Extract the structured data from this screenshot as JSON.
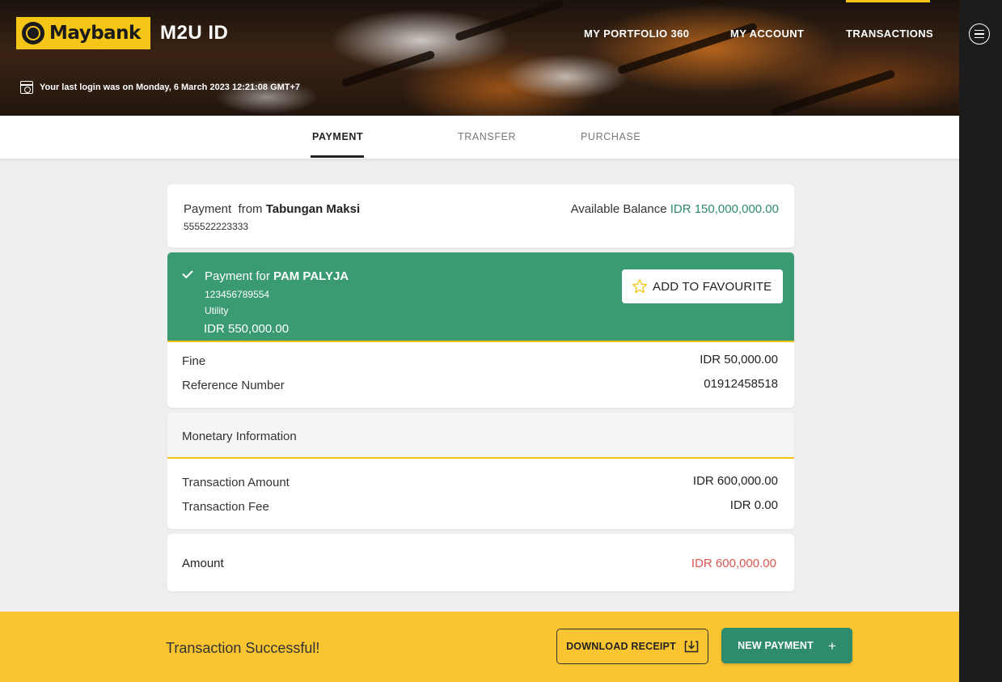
{
  "header": {
    "brand": "Maybank",
    "app_name": "M2U ID",
    "nav": {
      "portfolio": "MY PORTFOLIO 360",
      "account": "MY ACCOUNT",
      "transactions": "TRANSACTIONS"
    },
    "last_login": "Your last login was on Monday, 6 March 2023 12:21:08 GMT+7"
  },
  "tabs": {
    "payment": "PAYMENT",
    "transfer": "TRANSFER",
    "purchase": "PURCHASE",
    "active": "PAYMENT"
  },
  "source": {
    "label": "Payment",
    "from": "from",
    "account_name": "Tabungan Maksi",
    "account_number": "555522223333",
    "balance_label": "Available Balance",
    "balance_value": "IDR 150,000,000.00"
  },
  "payee": {
    "label": "Payment for",
    "name": "PAM PALYJA",
    "number": "123456789554",
    "category": "Utility",
    "amount": "IDR 550,000.00",
    "favourite_label": "ADD TO FAVOURITE",
    "rows": {
      "fine_label": "Fine",
      "fine_value": "IDR 50,000.00",
      "ref_label": "Reference Number",
      "ref_value": "01912458518"
    }
  },
  "monetary": {
    "title": "Monetary Information",
    "transaction_amount_label": "Transaction Amount",
    "transaction_amount_value": "IDR 600,000.00",
    "transaction_fee_label": "Transaction Fee",
    "transaction_fee_value": "IDR 0.00"
  },
  "total": {
    "label": "Amount",
    "value": "IDR 600,000.00"
  },
  "footer": {
    "status": "Transaction Successful!",
    "download_label": "DOWNLOAD RECEIPT",
    "new_payment_label": "NEW PAYMENT",
    "new_payment_icon": "+"
  },
  "colors": {
    "brand_yellow": "#f5c518",
    "footer_yellow": "#fbc531",
    "success_green": "#3a9b73",
    "button_green": "#2e8b6e",
    "amount_red": "#d9534f"
  },
  "icons": [
    "maybank-logo-icon",
    "calendar-icon",
    "hamburger-menu-icon",
    "check-icon",
    "star-icon",
    "download-icon",
    "plus-icon"
  ]
}
